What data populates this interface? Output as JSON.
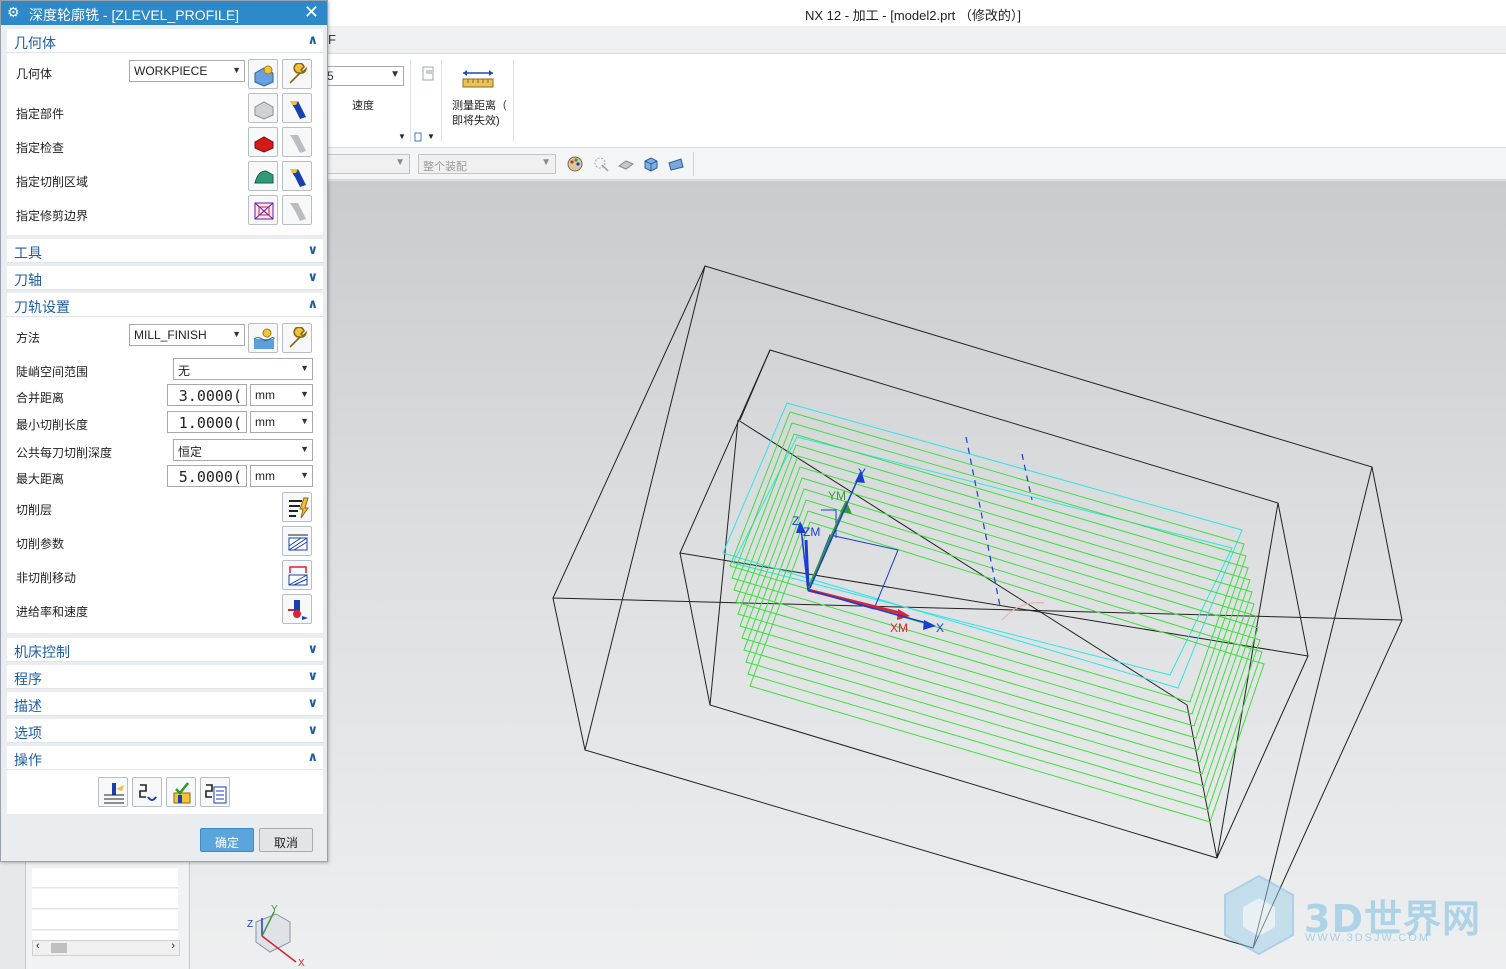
{
  "app": {
    "title": "NX 12 - 加工 - [model2.prt （修改的）]"
  },
  "menubar": {
    "partial_label": "F"
  },
  "ribbon": {
    "speed_combo_value": "5",
    "speed_label": "速度",
    "measure_label_line1": "测量距离（",
    "measure_label_line2": "即将失效)"
  },
  "quickbar": {
    "filter_placeholder": "",
    "assembly_scope": "整个装配"
  },
  "dialog": {
    "title": "深度轮廓铣 - [ZLEVEL_PROFILE]",
    "sections": {
      "geometry": {
        "title": "几何体"
      },
      "tool": {
        "title": "工具"
      },
      "axis": {
        "title": "刀轴"
      },
      "path": {
        "title": "刀轨设置"
      },
      "machine": {
        "title": "机床控制"
      },
      "program": {
        "title": "程序"
      },
      "description": {
        "title": "描述"
      },
      "options": {
        "title": "选项"
      },
      "actions": {
        "title": "操作"
      }
    },
    "geometry": {
      "geometry_label": "几何体",
      "geometry_value": "WORKPIECE",
      "part_label": "指定部件",
      "check_label": "指定检查",
      "cut_area_label": "指定切削区域",
      "trim_label": "指定修剪边界"
    },
    "path": {
      "method_label": "方法",
      "method_value": "MILL_FINISH",
      "steep_label": "陡峭空间范围",
      "steep_value": "无",
      "merge_label": "合并距离",
      "merge_value": "3.0000(",
      "merge_unit": "mm",
      "min_cut_label": "最小切削长度",
      "min_cut_value": "1.0000(",
      "min_cut_unit": "mm",
      "depth_label": "公共每刀切削深度",
      "depth_value": "恒定",
      "max_dist_label": "最大距离",
      "max_dist_value": "5.0000(",
      "max_dist_unit": "mm",
      "cut_levels_label": "切削层",
      "cut_params_label": "切削参数",
      "non_cut_label": "非切削移动",
      "feeds_label": "进给率和速度"
    },
    "buttons": {
      "ok": "确定",
      "cancel": "取消"
    }
  },
  "viewport": {
    "labels": {
      "y": "Y",
      "ym": "YM",
      "z": "Z",
      "zm": "ZM",
      "x": "X",
      "xm": "XM"
    },
    "triad": {
      "y": "Y",
      "z": "Z",
      "x": "X"
    }
  },
  "watermark": {
    "text": "3D世界网",
    "sub": "WWW.3DSJW.COM"
  },
  "colors": {
    "dialog_title": "#2d89c8",
    "section_title": "#1d5fa3",
    "toolpath_green": "#3ee03e",
    "toolpath_cyan": "#2ee6e6",
    "ok_button": "#5aa6dc"
  }
}
